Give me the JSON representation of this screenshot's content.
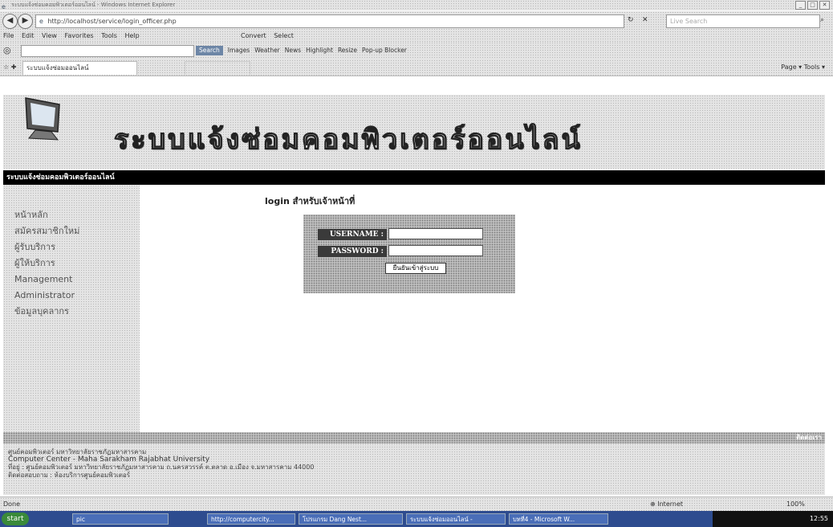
{
  "window": {
    "title": "ระบบแจ้งซ่อมคอมพิวเตอร์ออนไลน์ - Windows Internet Explorer",
    "controls": [
      "_",
      "□",
      "✕"
    ]
  },
  "address": {
    "url": "http://localhost/service/login_officer.php",
    "search_placeholder": "Live Search"
  },
  "menu": {
    "items": [
      "File",
      "Edit",
      "View",
      "Favorites",
      "Tools",
      "Help"
    ],
    "convert": "Convert",
    "select": "Select"
  },
  "toolbar": {
    "search": "Search",
    "images": "Images",
    "weather": "Weather",
    "news": "News",
    "highlight": "Highlight",
    "resize": "Resize",
    "popup": "Pop-up Blocker"
  },
  "favorites": {
    "tab_title": "ระบบแจ้งซ่อมออนไลน์",
    "commands": "Page ▾   Tools ▾"
  },
  "site": {
    "title": "ระบบแจ้งซ่อมคอมพิวเตอร์ออนไลน์",
    "navbar": "ระบบแจ้งซ่อมคอมพิวเตอร์ออนไลน์"
  },
  "sidebar": {
    "items": [
      "หน้าหลัก",
      "สมัครสมาชิกใหม่",
      "ผู้รับบริการ",
      "ผู้ให้บริการ",
      "Management",
      "Administrator",
      "ข้อมูลบุคลากร"
    ]
  },
  "login": {
    "heading": "login สำหรับเจ้าหน้าที่",
    "username_label": "USERNAME :",
    "password_label": "PASSWORD :",
    "submit": "ยืนยันเข้าสู่ระบบ"
  },
  "footer": {
    "right": "ติดต่อเรา",
    "line1": "ศูนย์คอมพิวเตอร์ มหาวิทยาลัยราชภัฏมหาสารคาม",
    "line2": "Computer Center - Maha Sarakham Rajabhat University",
    "line3": "ที่อยู่ : ศูนย์คอมพิวเตอร์ มหาวิทยาลัยราชภัฏมหาสารคาม ถ.นครสวรรค์ ต.ตลาด อ.เมือง จ.มหาสารคาม 44000",
    "line4": "ติดต่อสอบถาม : ห้องบริการศูนย์คอมพิวเตอร์"
  },
  "status": {
    "text": "Done",
    "zone": "Internet",
    "zoom": "100%"
  },
  "taskbar": {
    "start": "start",
    "buttons": [
      "pic",
      "http://computercity...",
      "โปรแกรม Dang Nest...",
      "ระบบแจ้งซ่อมออนไลน์ -",
      "บทที่4 - Microsoft W..."
    ],
    "clock": "12:55"
  }
}
